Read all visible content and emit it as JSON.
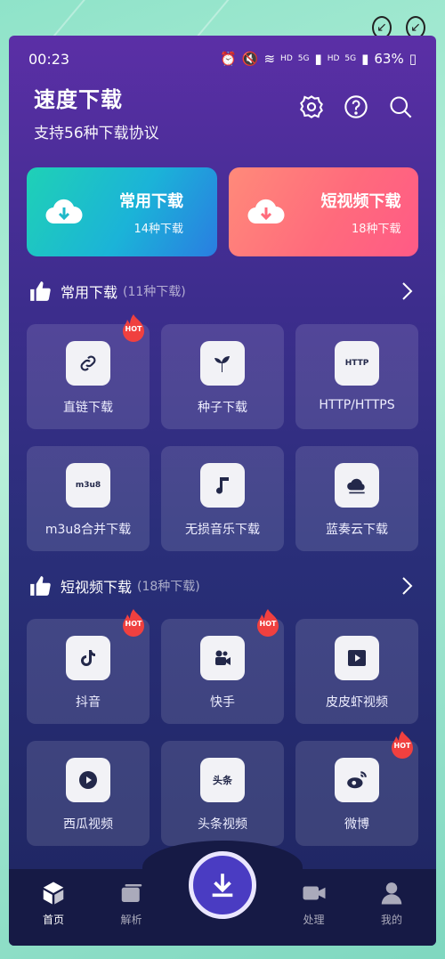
{
  "status_bar": {
    "time": "00:23",
    "net_hd1": "HD",
    "net_5g1": "5G",
    "net_hd2": "HD",
    "net_5g2": "5G",
    "battery": "63%"
  },
  "header": {
    "title": "速度下载",
    "subtitle": "支持56种下载协议",
    "icons": [
      "settings-icon",
      "help-icon",
      "search-icon"
    ]
  },
  "big_cards": [
    {
      "title": "常用下载",
      "sub": "14种下载",
      "color": "#1fd1b6"
    },
    {
      "title": "短视频下载",
      "sub": "18种下载",
      "color": "#ff6b7c"
    }
  ],
  "sections": [
    {
      "name": "常用下载",
      "count": "(11种下载)",
      "items": [
        {
          "label": "直链下载",
          "icon": "link-icon",
          "hot": true
        },
        {
          "label": "种子下载",
          "icon": "sprout-icon",
          "hot": false
        },
        {
          "label": "HTTP/HTTPS",
          "icon": "http-icon",
          "icon_text": "HTTP",
          "hot": false
        },
        {
          "label": "m3u8合并下载",
          "icon": "m3u8-icon",
          "icon_text": "m3u8",
          "hot": false
        },
        {
          "label": "无损音乐下载",
          "icon": "music-note-icon",
          "hot": false
        },
        {
          "label": "蓝奏云下载",
          "icon": "cloud-icon",
          "hot": false
        }
      ]
    },
    {
      "name": "短视频下载",
      "count": "(18种下载)",
      "items": [
        {
          "label": "抖音",
          "icon": "tiktok-icon",
          "hot": true
        },
        {
          "label": "快手",
          "icon": "kuaishou-icon",
          "hot": true
        },
        {
          "label": "皮皮虾视频",
          "icon": "play-square-icon",
          "hot": false
        },
        {
          "label": "西瓜视频",
          "icon": "play-circle-icon",
          "hot": false
        },
        {
          "label": "头条视频",
          "icon": "toutiao-icon",
          "icon_text": "头条",
          "hot": false
        },
        {
          "label": "微博",
          "icon": "weibo-icon",
          "hot": true
        }
      ]
    }
  ],
  "hot_label": "HOT",
  "bottom_nav": [
    {
      "label": "首页",
      "icon": "home-cube-icon",
      "active": true
    },
    {
      "label": "解析",
      "icon": "cards-icon",
      "active": false
    },
    {
      "label": "处理",
      "icon": "video-camera-icon",
      "active": false
    },
    {
      "label": "我的",
      "icon": "user-icon",
      "active": false
    }
  ]
}
